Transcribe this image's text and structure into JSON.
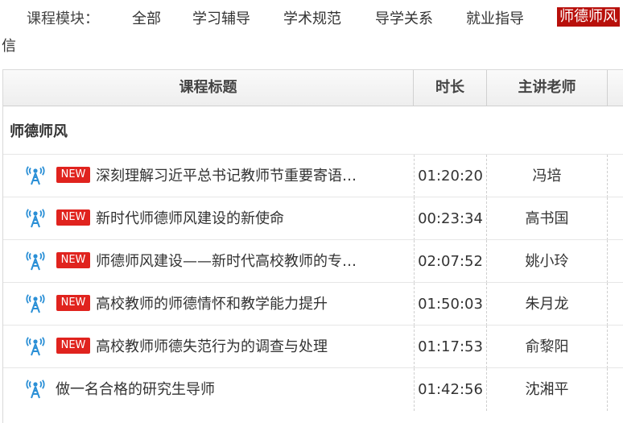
{
  "module_bar": {
    "label": "课程模块：",
    "items": [
      "全部",
      "学习辅导",
      "学术规范",
      "导学关系",
      "就业指导",
      "师德师风"
    ],
    "wrap_char": "信",
    "active_color": "#b8100b"
  },
  "table": {
    "headers": [
      "课程标题",
      "时长",
      "主讲老师"
    ],
    "section_title": "师德师风",
    "rows": [
      {
        "icon": "podcast-icon",
        "new": "NEW",
        "title": "深刻理解习近平总书记教师节重要寄语…",
        "duration": "01:20:20",
        "teacher": "冯培"
      },
      {
        "icon": "podcast-icon",
        "new": "NEW",
        "title": "新时代师德师风建设的新使命",
        "duration": "00:23:34",
        "teacher": "高书国"
      },
      {
        "icon": "podcast-icon",
        "new": "NEW",
        "title": "师德师风建设——新时代高校教师的专…",
        "duration": "02:07:52",
        "teacher": "姚小玲"
      },
      {
        "icon": "podcast-icon",
        "new": "NEW",
        "title": "高校教师的师德情怀和教学能力提升",
        "duration": "01:50:03",
        "teacher": "朱月龙"
      },
      {
        "icon": "podcast-icon",
        "new": "NEW",
        "title": "高校教师师德失范行为的调查与处理",
        "duration": "01:17:53",
        "teacher": "俞黎阳"
      },
      {
        "icon": "podcast-icon",
        "new": "",
        "title": "做一名合格的研究生导师",
        "duration": "01:42:56",
        "teacher": "沈湘平"
      }
    ]
  },
  "colors": {
    "new_badge": "#e0231e",
    "icon": "#2a8fd6"
  }
}
